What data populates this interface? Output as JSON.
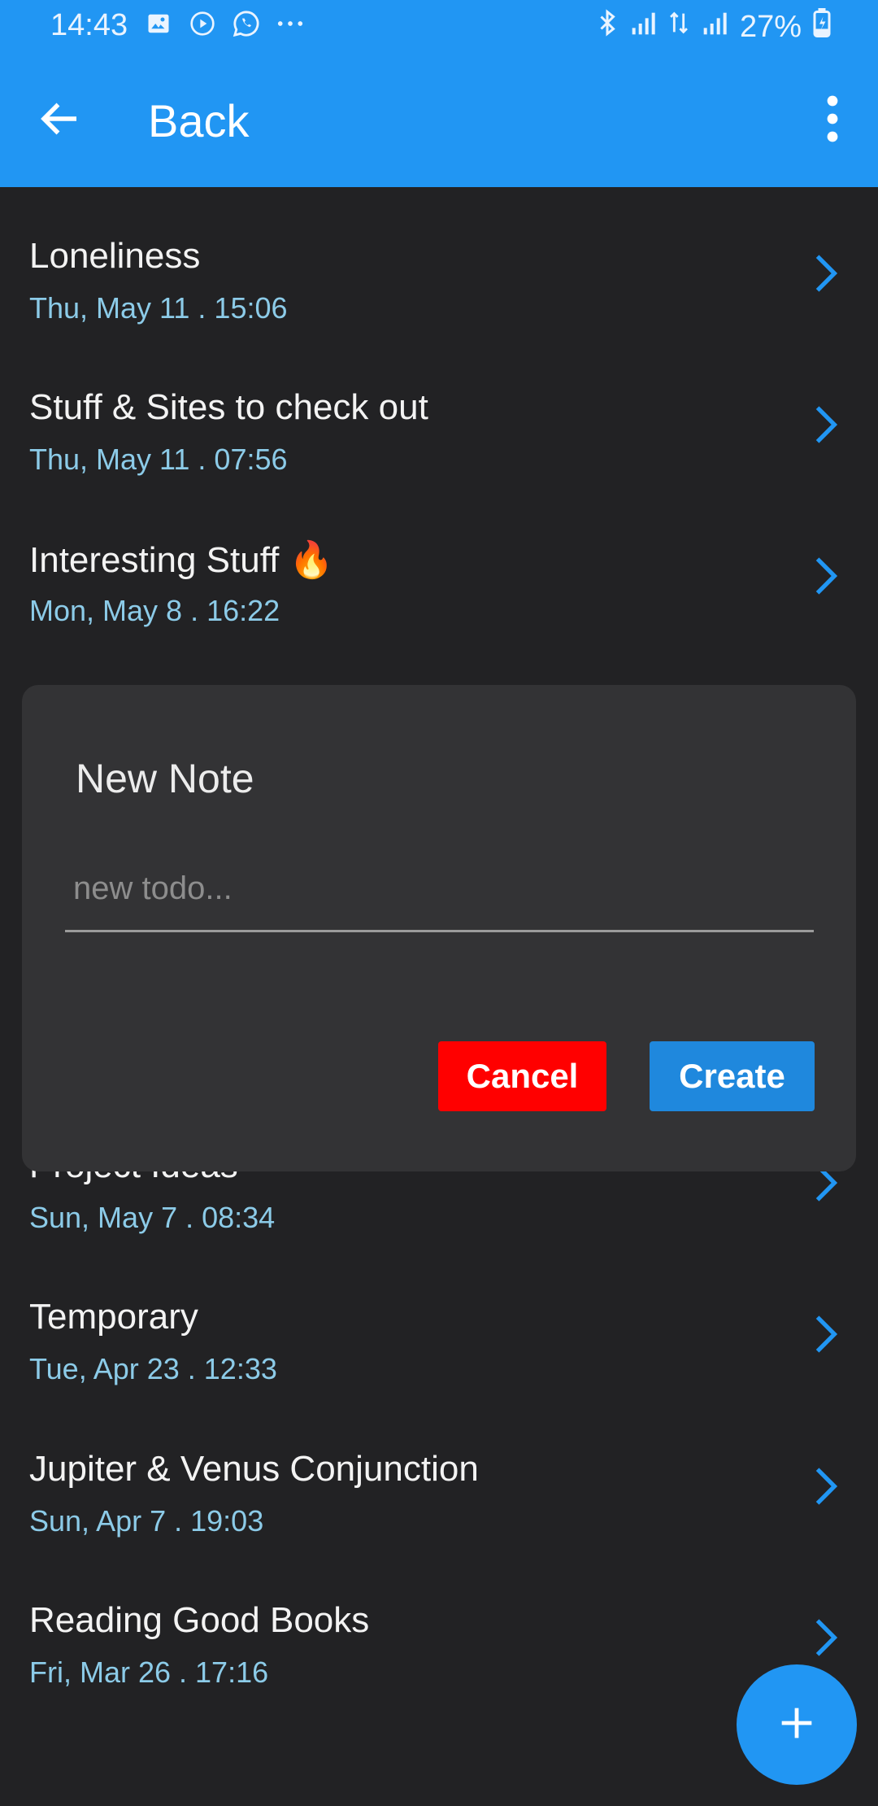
{
  "status_bar": {
    "time": "14:43",
    "battery": "27%",
    "icons": [
      "gallery-icon",
      "play-icon",
      "whatsapp-icon",
      "more-dots-icon",
      "bluetooth-icon",
      "signal-icon",
      "data-icon",
      "signal-icon",
      "battery-charging-icon"
    ]
  },
  "app_bar": {
    "title": "Back",
    "back_icon": "arrow-left-icon",
    "menu_icon": "more-vert-icon"
  },
  "notes": [
    {
      "title": "Loneliness",
      "date": "Thu, May 11 . 15:06"
    },
    {
      "title": "Stuff & Sites to check out",
      "date": "Thu, May 11 . 07:56"
    },
    {
      "title": "Interesting Stuff 🔥",
      "date": "Mon, May 8 . 16:22"
    },
    {
      "title": "Project Ideas",
      "date": "Sun, May 7 . 08:34"
    },
    {
      "title": "Temporary",
      "date": "Tue, Apr 23 . 12:33"
    },
    {
      "title": "Jupiter & Venus Conjunction",
      "date": "Sun, Apr 7 . 19:03"
    },
    {
      "title": "Reading Good Books",
      "date": "Fri, Mar 26 . 17:16"
    }
  ],
  "dialog": {
    "title": "New Note",
    "input_value": "",
    "input_placeholder": "new todo...",
    "cancel_label": "Cancel",
    "create_label": "Create"
  },
  "fab": {
    "icon": "plus-icon"
  },
  "colors": {
    "accent": "#2196f3",
    "background": "#222224",
    "dialog": "#333335",
    "date_text": "#8ccbe8",
    "cancel": "#ff0000",
    "create": "#1f88dd"
  }
}
